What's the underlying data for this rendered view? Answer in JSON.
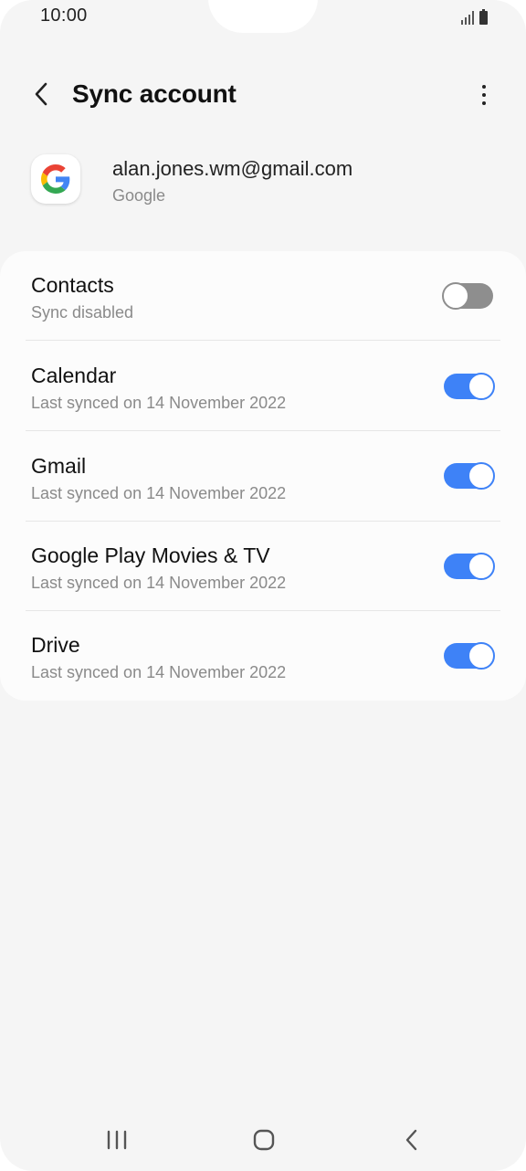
{
  "status_bar": {
    "time": "10:00",
    "icons": [
      "signal-icon",
      "battery-icon"
    ]
  },
  "header": {
    "title": "Sync account",
    "back_icon": "back-arrow-icon",
    "more_icon": "more-vertical-icon"
  },
  "account": {
    "email": "alan.jones.wm@gmail.com",
    "type": "Google",
    "icon": "google-icon"
  },
  "sync_items": [
    {
      "label": "Contacts",
      "status": "Sync disabled",
      "enabled": false
    },
    {
      "label": "Calendar",
      "status": "Last synced on 14 November 2022",
      "enabled": true
    },
    {
      "label": "Gmail",
      "status": "Last synced on 14 November 2022",
      "enabled": true
    },
    {
      "label": "Google Play Movies & TV",
      "status": "Last synced on 14 November 2022",
      "enabled": true
    },
    {
      "label": "Drive",
      "status": "Last synced on 14 November 2022",
      "enabled": true
    }
  ],
  "nav_bar": {
    "icons": [
      "recents-icon",
      "home-icon",
      "back-icon"
    ]
  },
  "colors": {
    "background": "#f5f5f5",
    "card": "#fcfcfc",
    "toggle_on": "#3e82f7",
    "toggle_off": "#8e8e8e"
  }
}
